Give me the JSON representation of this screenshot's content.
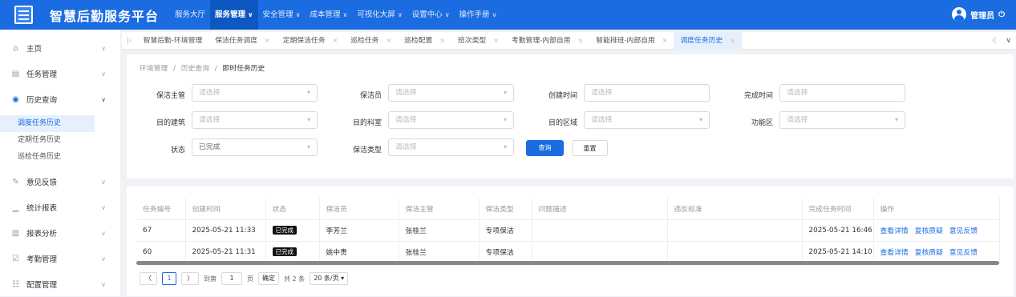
{
  "header": {
    "title": "智慧后勤服务平台",
    "nav": [
      {
        "label": "服务大厅",
        "chevron": false,
        "active": false
      },
      {
        "label": "服务管理",
        "chevron": true,
        "active": true
      },
      {
        "label": "安全管理",
        "chevron": true,
        "active": false
      },
      {
        "label": "成本管理",
        "chevron": true,
        "active": false
      },
      {
        "label": "可视化大屏",
        "chevron": true,
        "active": false
      },
      {
        "label": "设置中心",
        "chevron": true,
        "active": false
      },
      {
        "label": "操作手册",
        "chevron": true,
        "active": false
      }
    ],
    "user": "管理员"
  },
  "sidebar": {
    "items": [
      {
        "label": "主页",
        "icon": "home-icon"
      },
      {
        "label": "任务管理",
        "icon": "task-icon"
      },
      {
        "label": "历史查询",
        "icon": "history-icon",
        "open": true
      },
      {
        "label": "意见反馈",
        "icon": "feedback-icon"
      },
      {
        "label": "统计报表",
        "icon": "stats-icon"
      },
      {
        "label": "报表分析",
        "icon": "analysis-icon"
      },
      {
        "label": "考勤管理",
        "icon": "attendance-icon"
      },
      {
        "label": "配置管理",
        "icon": "config-icon"
      }
    ],
    "sub_items": [
      "调度任务历史",
      "定期任务历史",
      "巡检任务历史"
    ],
    "active_sub": "调度任务历史"
  },
  "tabs": [
    "智慧后勤-环境管理",
    "保洁任务调度",
    "定期保洁任务",
    "巡检任务",
    "巡检配置",
    "班次类型",
    "考勤管理-内部自用",
    "智能排班-内部自用",
    "调度任务历史"
  ],
  "active_tab": "调度任务历史",
  "breadcrumb": {
    "p1": "环境管理",
    "p2": "历史查询",
    "current": "即时任务历史",
    "sep": "/"
  },
  "filters": {
    "supervisor": {
      "label": "保洁主管",
      "placeholder": "请选择"
    },
    "cleaner": {
      "label": "保洁员",
      "placeholder": "请选择"
    },
    "create_time": {
      "label": "创建时间",
      "placeholder": "请选择"
    },
    "finish_time": {
      "label": "完成时间",
      "placeholder": "请选择"
    },
    "building": {
      "label": "目的建筑",
      "placeholder": "请选择"
    },
    "dept": {
      "label": "目的科室",
      "placeholder": "请选择"
    },
    "area": {
      "label": "目的区域",
      "placeholder": "请选择"
    },
    "func_area": {
      "label": "功能区",
      "placeholder": "请选择"
    },
    "status": {
      "label": "状态",
      "value": "已完成"
    },
    "clean_type": {
      "label": "保洁类型",
      "placeholder": "请选择"
    }
  },
  "buttons": {
    "search": "查询",
    "reset": "重置"
  },
  "table": {
    "columns": [
      "任务编号",
      "创建时间",
      "状态",
      "保洁员",
      "保洁主管",
      "保洁类型",
      "问题描述",
      "违反标准",
      "完成任务时间",
      "操作"
    ],
    "rows": [
      {
        "id": "67",
        "created": "2025-05-21 11:33",
        "status": "已完成",
        "cleaner": "李芳兰",
        "supervisor": "张桂兰",
        "type": "专项保洁",
        "problem": "",
        "violation": "",
        "finished": "2025-05-21 16:46"
      },
      {
        "id": "60",
        "created": "2025-05-21 11:31",
        "status": "已完成",
        "cleaner": "姚中贵",
        "supervisor": "张桂兰",
        "type": "专项保洁",
        "problem": "",
        "violation": "",
        "finished": "2025-05-21 14:10"
      }
    ],
    "actions": [
      "查看详情",
      "复核质疑",
      "意见反馈"
    ]
  },
  "pager": {
    "current": "1",
    "goto_prefix": "到第",
    "goto_value": "1",
    "goto_suffix": "页",
    "confirm": "确定",
    "total": "共 2 条",
    "page_size": "20 条/页"
  }
}
